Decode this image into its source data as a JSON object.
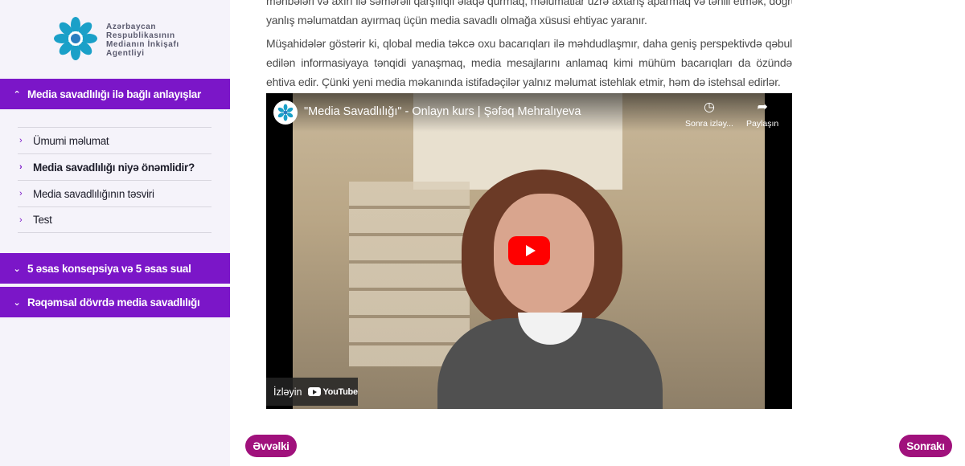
{
  "logo": {
    "lines": [
      "Azərbaycan",
      "Respublikasının",
      "Medianın İnkişafı",
      "Agentliyi"
    ]
  },
  "sidebar": {
    "sections": [
      {
        "label": "Media savadlılığı ilə bağlı anlayışlar",
        "expanded": true,
        "items": [
          {
            "label": "Ümumi məlumat"
          },
          {
            "label": "Media savadlılığı niyə önəmlidir?",
            "active": true
          },
          {
            "label": "Media savadlılığının təsviri"
          },
          {
            "label": "Test"
          }
        ]
      },
      {
        "label": "5 əsas konsepsiya və 5 əsas sual",
        "expanded": false
      },
      {
        "label": "Rəqəmsal dövrdə media savadlılığı",
        "expanded": false
      }
    ]
  },
  "content": {
    "paragraph_1_line1": "mənbələri və axırı ilə səmərəli qarşılıqlı əlaqə qurmaq, məlumatlar üzrə axtarış aparmaq və təhlil etmək, doğru məlumatı",
    "paragraph_1_line2": "yanlış məlumatdan ayırmaq üçün media savadlı olmağa xüsusi ehtiyac yaranır.",
    "paragraph_2": "Müşahidələr göstərir ki, qlobal media təkcə oxu bacarıqları ilə məhdudlaşmır, daha geniş perspektivdə qəbul edilən informasiyaya tənqidi yanaşmaq, media mesajlarını anlamaq kimi mühüm bacarıqları da özündə ehtiva edir. Çünki yeni media məkanında istifadəçilər yalnız məlumat istehlak etmir, həm də istehsal edirlər."
  },
  "video": {
    "title": "\"Media Savadlılığı\" - Onlayn kurs | Şəfəq Mehralıyeva",
    "watch_later": "Sonra izləy...",
    "share": "Paylaşın",
    "watch_on": "İzləyin",
    "youtube": "YouTube"
  },
  "nav": {
    "prev": "Əvvəlki",
    "next": "Sonrakı"
  },
  "colors": {
    "accent_purple": "#7b16c8",
    "nav_magenta": "#a0117c",
    "youtube_red": "#ff0000"
  }
}
